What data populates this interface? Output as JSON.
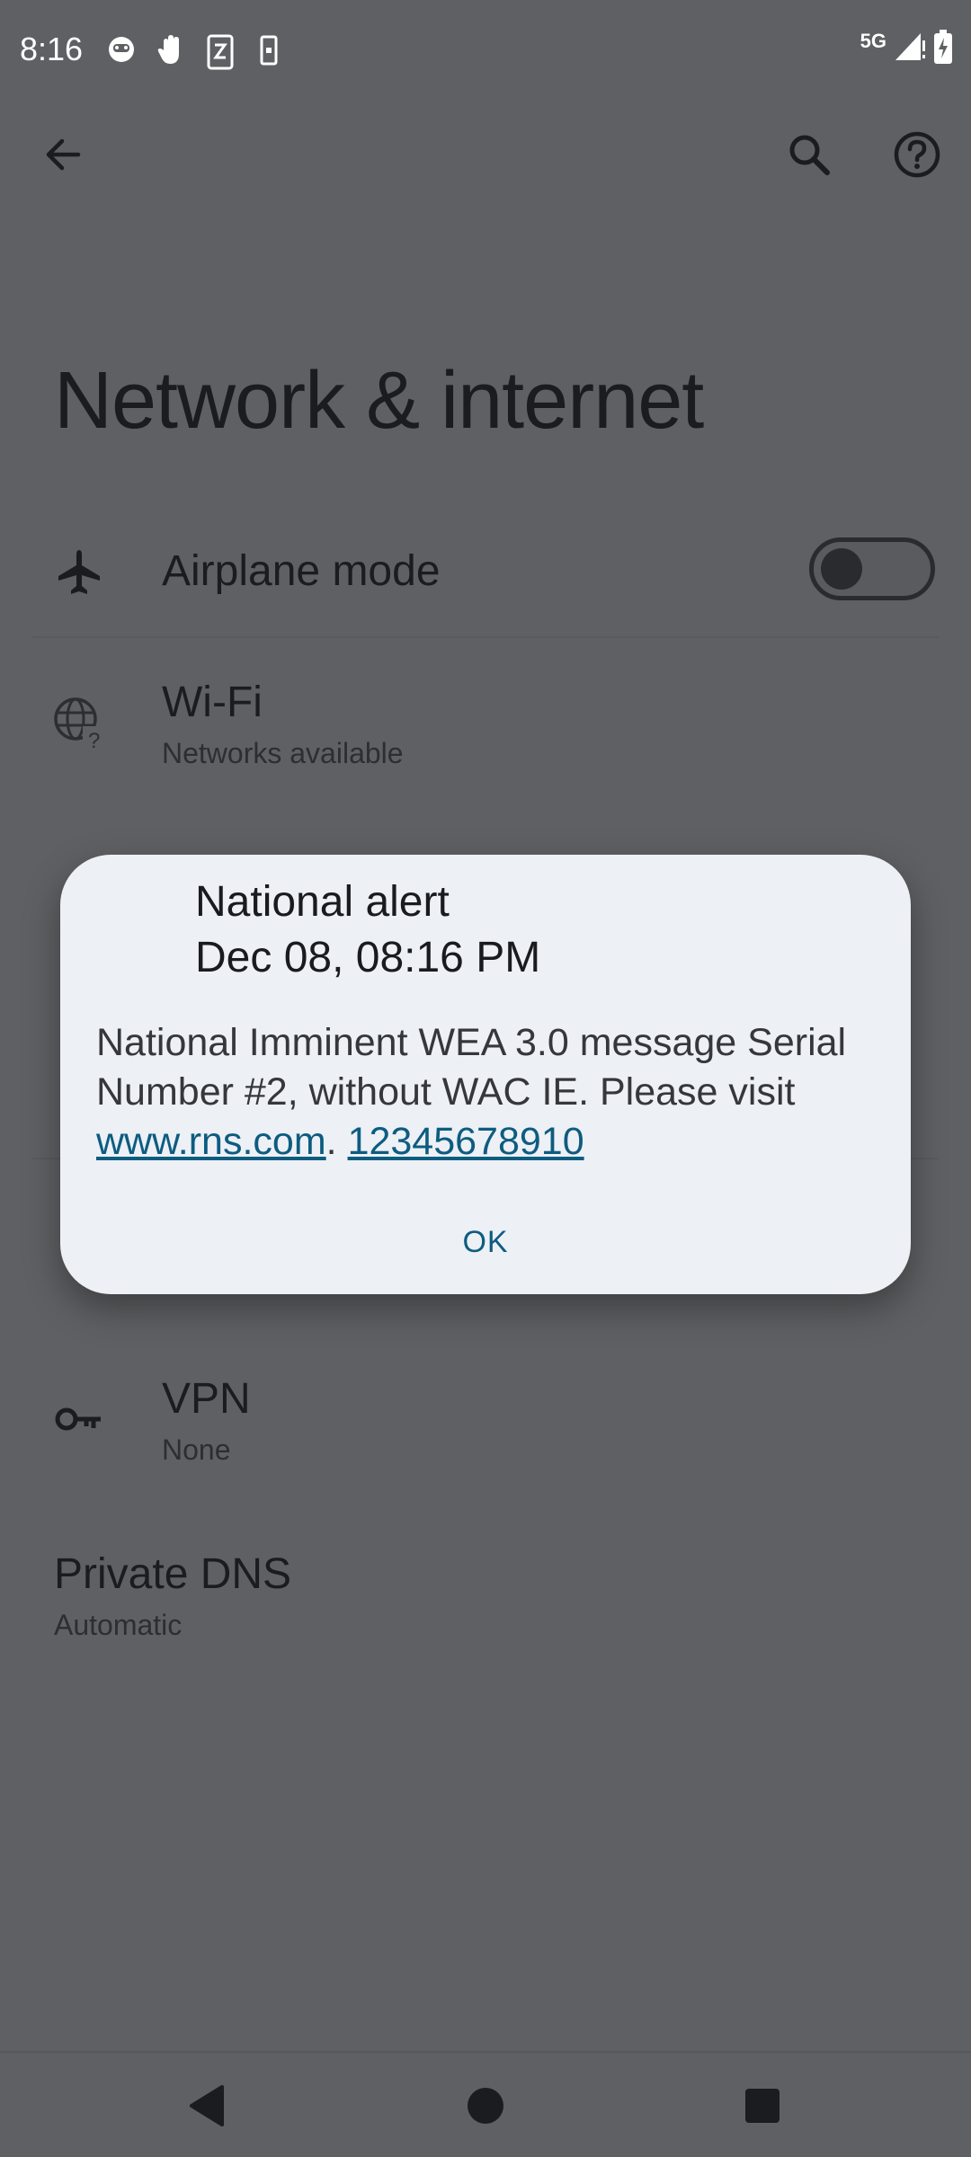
{
  "status_bar": {
    "time": "8:16",
    "network": "5G",
    "icons": [
      "face-icon",
      "hand-icon",
      "sim-transfer-icon",
      "phone-icon",
      "signal-icon",
      "battery-charging-icon"
    ]
  },
  "app_bar": {
    "back_icon": "arrow-left-icon",
    "search_icon": "search-icon",
    "help_icon": "help-circle-icon"
  },
  "page": {
    "title": "Network & internet"
  },
  "settings": {
    "airplane": {
      "title": "Airplane mode",
      "icon": "airplane-icon",
      "enabled": false
    },
    "wifi": {
      "title": "Wi-Fi",
      "subtitle": "Networks available",
      "icon": "globe-question-icon"
    },
    "vpn": {
      "title": "VPN",
      "subtitle": "None",
      "icon": "key-icon"
    },
    "private_dns": {
      "title": "Private DNS",
      "subtitle": "Automatic"
    }
  },
  "dialog": {
    "title_line1": "National alert",
    "title_line2": "Dec 08, 08:16 PM",
    "body_prefix": "National Imminent WEA 3.0 message Serial Number #2, without WAC IE. Please visit ",
    "link_url": "www.rns.com",
    "body_sep": ". ",
    "link_phone": "12345678910",
    "ok_label": "OK"
  },
  "nav_bar": {
    "back": "back-triangle-icon",
    "home": "home-circle-icon",
    "recents": "recents-square-icon"
  },
  "colors": {
    "scrim_bg": "#5f6063",
    "dialog_bg": "#edf0f5",
    "accent": "#0d5c80"
  }
}
